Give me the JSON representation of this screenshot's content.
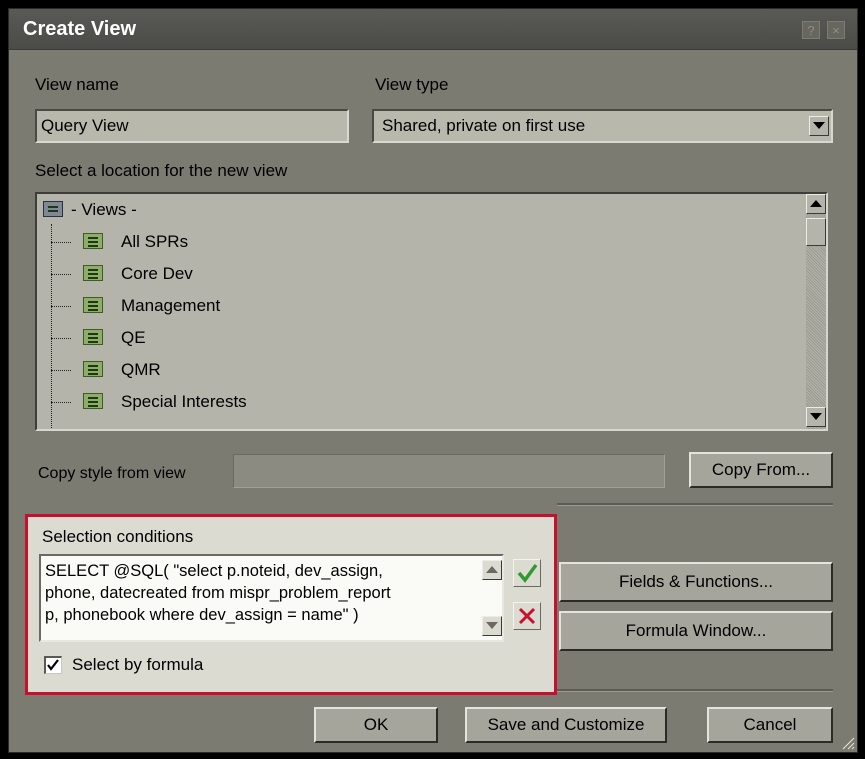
{
  "window": {
    "title": "Create View",
    "help_glyph": "?",
    "close_glyph": "×"
  },
  "view_name": {
    "label": "View name",
    "value": "Query View"
  },
  "view_type": {
    "label": "View type",
    "value": "Shared, private on first use"
  },
  "location": {
    "label": "Select a location for the new view",
    "root": "- Views -",
    "items": [
      "All SPRs",
      "Core Dev",
      "Management",
      "QE",
      "QMR",
      "Special Interests"
    ]
  },
  "copy_style": {
    "label": "Copy style from view",
    "value": "",
    "button": "Copy From..."
  },
  "selection": {
    "label": "Selection conditions",
    "formula_lines": [
      "SELECT @SQL( \"select p.noteid, dev_assign,",
      "phone, datecreated from mispr_problem_report",
      "p, phonebook where dev_assign = name\" )"
    ],
    "checkbox_label": "Select by formula",
    "checkbox_checked": true
  },
  "side_buttons": {
    "fields": "Fields & Functions...",
    "formula_window": "Formula Window..."
  },
  "footer": {
    "ok": "OK",
    "save_customize": "Save and Customize",
    "cancel": "Cancel"
  },
  "colors": {
    "accept": "#2f9a2f",
    "reject": "#c8102e",
    "highlight_border": "#c8102e"
  }
}
